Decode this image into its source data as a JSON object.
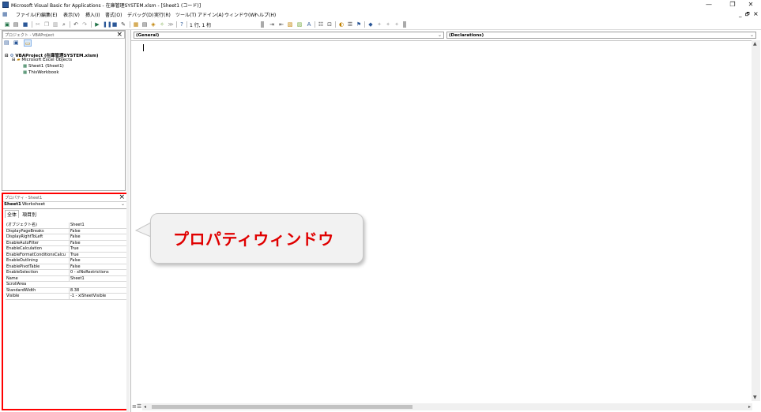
{
  "window": {
    "title": "Microsoft Visual Basic for Applications - 在庫管理SYSTEM.xlsm - [Sheet1 (コード)]",
    "minimize": "—",
    "restore": "❐",
    "close": "✕",
    "inner_min": "_",
    "inner_restore": "🗗",
    "inner_close": "×"
  },
  "menu": {
    "items": [
      "ファイル(F)",
      "編集(E)",
      "表示(V)",
      "挿入(I)",
      "書式(O)",
      "デバッグ(D)",
      "実行(R)",
      "ツール(T)",
      "アドイン(A)",
      "ウィンドウ(W)",
      "ヘルプ(H)"
    ]
  },
  "toolbar": {
    "position": "1 行, 1 桁"
  },
  "project": {
    "header": "プロジェクト - VBAProject",
    "root": "VBAProject (在庫管理SYSTEM.xlsm)",
    "folder": "Microsoft Excel Objects",
    "items": [
      "Sheet1 (Sheet1)",
      "ThisWorkbook"
    ]
  },
  "properties": {
    "header": "プロパティ - Sheet1",
    "object_name": "Sheet1",
    "object_type": "Worksheet",
    "tabs": [
      "全体",
      "項目別"
    ],
    "rows": [
      {
        "k": "(オブジェクト名)",
        "v": "Sheet1"
      },
      {
        "k": "DisplayPageBreaks",
        "v": "False"
      },
      {
        "k": "DisplayRightToLeft",
        "v": "False"
      },
      {
        "k": "EnableAutoFilter",
        "v": "False"
      },
      {
        "k": "EnableCalculation",
        "v": "True"
      },
      {
        "k": "EnableFormatConditionsCalcu",
        "v": "True"
      },
      {
        "k": "EnableOutlining",
        "v": "False"
      },
      {
        "k": "EnablePivotTable",
        "v": "False"
      },
      {
        "k": "EnableSelection",
        "v": "0 - xlNoRestrictions"
      },
      {
        "k": "Name",
        "v": "Sheet1"
      },
      {
        "k": "ScrollArea",
        "v": ""
      },
      {
        "k": "StandardWidth",
        "v": "8.38"
      },
      {
        "k": "Visible",
        "v": "-1 - xlSheetVisible"
      }
    ]
  },
  "code": {
    "object_combo": "(General)",
    "proc_combo": "(Declarations)"
  },
  "callout": {
    "text": "プロパティウィンドウ"
  },
  "colors": {
    "highlight_border": "#ff0000",
    "callout_text": "#e00000"
  }
}
